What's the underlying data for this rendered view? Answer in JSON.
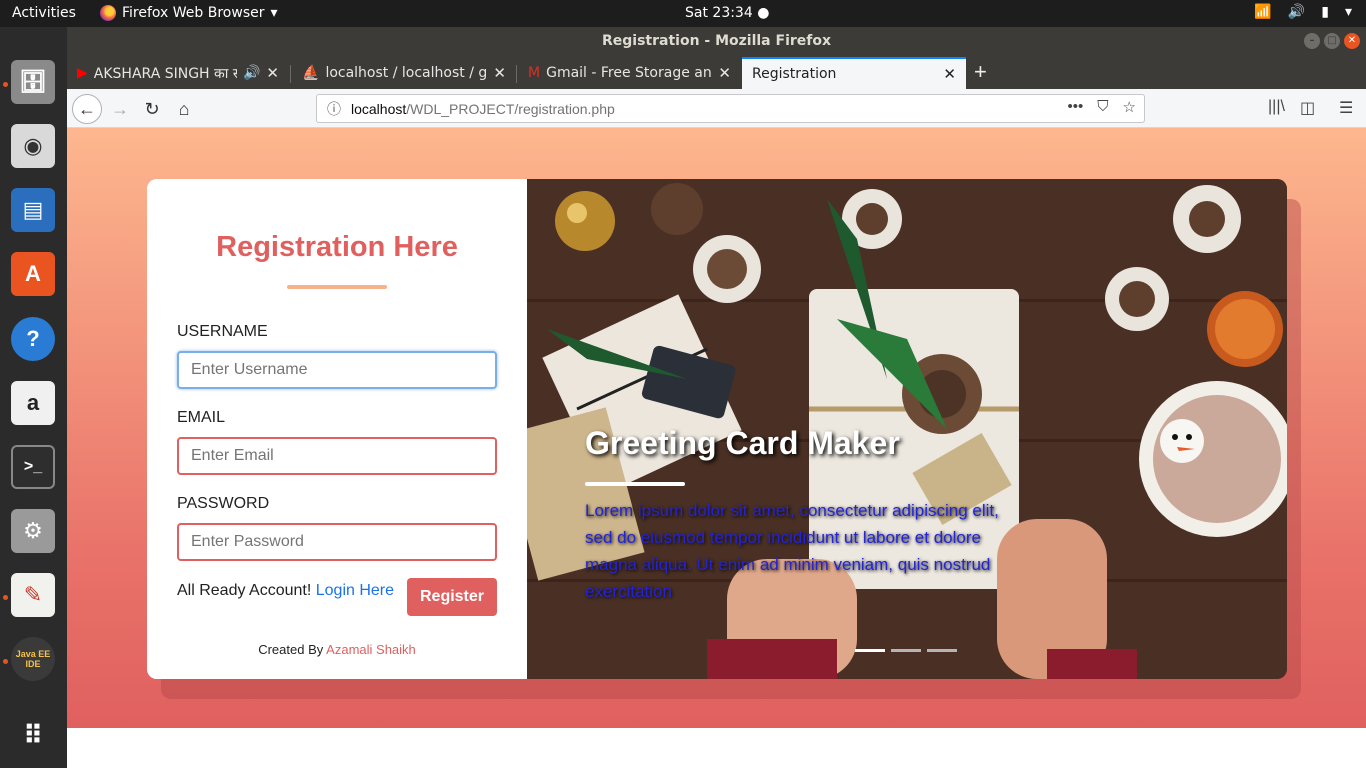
{
  "topbar": {
    "activities": "Activities",
    "app_name": "Firefox Web Browser",
    "clock": "Sat 23:34"
  },
  "dock": {
    "items": [
      {
        "name": "files-icon",
        "color": "#8a8a8a"
      },
      {
        "name": "rhythmbox-icon",
        "color": "#d9d9d9"
      },
      {
        "name": "writer-icon",
        "color": "#2a6ebd"
      },
      {
        "name": "software-center-icon",
        "color": "#e95420"
      },
      {
        "name": "help-icon",
        "color": "#2a7bd3"
      },
      {
        "name": "amazon-icon",
        "color": "#f0f0f0"
      },
      {
        "name": "terminal-icon",
        "color": "#2e2e2e"
      },
      {
        "name": "settings-icon",
        "color": "#9a9a9a"
      },
      {
        "name": "text-editor-icon",
        "color": "#f1f1ee"
      },
      {
        "name": "eclipse-javaee-icon",
        "color": "#3a3a3a"
      },
      {
        "name": "show-apps-icon",
        "color": "#2b2b2b"
      }
    ],
    "javaee_label": "Java EE IDE"
  },
  "window": {
    "title": "Registration - Mozilla Firefox"
  },
  "tabs": [
    {
      "title": "AKSHARA SINGH का स",
      "active": false
    },
    {
      "title": "localhost / localhost / gl",
      "active": false
    },
    {
      "title": "Gmail - Free Storage and",
      "active": false
    },
    {
      "title": "Registration",
      "active": true
    }
  ],
  "urlbar": {
    "host": "localhost",
    "path": "/WDL_PROJECT/registration.php"
  },
  "form": {
    "heading": "Registration Here",
    "username_label": "USERNAME",
    "username_placeholder": "Enter Username",
    "email_label": "EMAIL",
    "email_placeholder": "Enter Email",
    "password_label": "PASSWORD",
    "password_placeholder": "Enter Password",
    "account_prompt": "All Ready Account!",
    "login_link": "Login Here",
    "register_button": "Register",
    "credit_prefix": "Created By",
    "credit_author": "Azamali Shaikh"
  },
  "hero": {
    "heading": "Greeting Card Maker",
    "text": "Lorem ipsum dolor sit amet, consectetur adipiscing elit, sed do eiusmod tempor incididunt ut labore et dolore magna aliqua. Ut enim ad minim veniam, quis nostrud exercitation",
    "slides": 3,
    "active_slide": 1
  },
  "colors": {
    "accent": "#e0605f",
    "link": "#1a73e8",
    "gradient_top": "#fdb78e",
    "gradient_bottom": "#e0605f"
  }
}
